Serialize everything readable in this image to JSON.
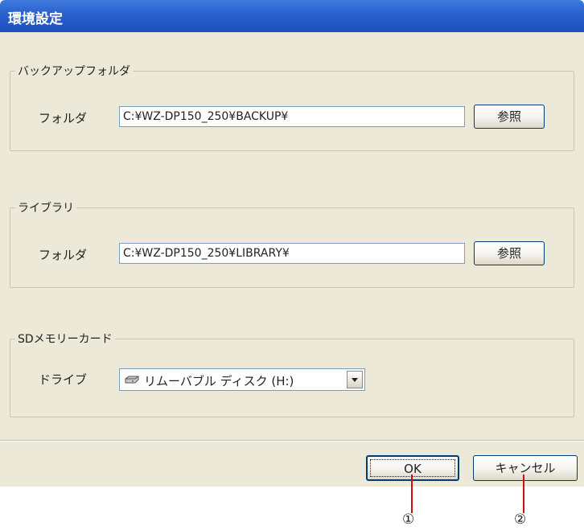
{
  "window": {
    "title": "環境設定"
  },
  "backup": {
    "group_label": "バックアップフォルダ",
    "folder_label": "フォルダ",
    "path": "C:¥WZ-DP150_250¥BACKUP¥",
    "browse_label": "参照"
  },
  "library": {
    "group_label": "ライブラリ",
    "folder_label": "フォルダ",
    "path": "C:¥WZ-DP150_250¥LIBRARY¥",
    "browse_label": "参照"
  },
  "sdcard": {
    "group_label": "SDメモリーカード",
    "drive_label": "ドライブ",
    "drive_value": "リムーバブル ディスク (H:)",
    "drive_icon": "removable-disk-icon"
  },
  "footer": {
    "ok_label": "OK",
    "cancel_label": "キャンセル"
  },
  "callouts": [
    "①",
    "②"
  ],
  "colors": {
    "title_bar": "#2a62d0",
    "dialog_bg": "#ece9d8",
    "callout_line": "#d01010"
  }
}
